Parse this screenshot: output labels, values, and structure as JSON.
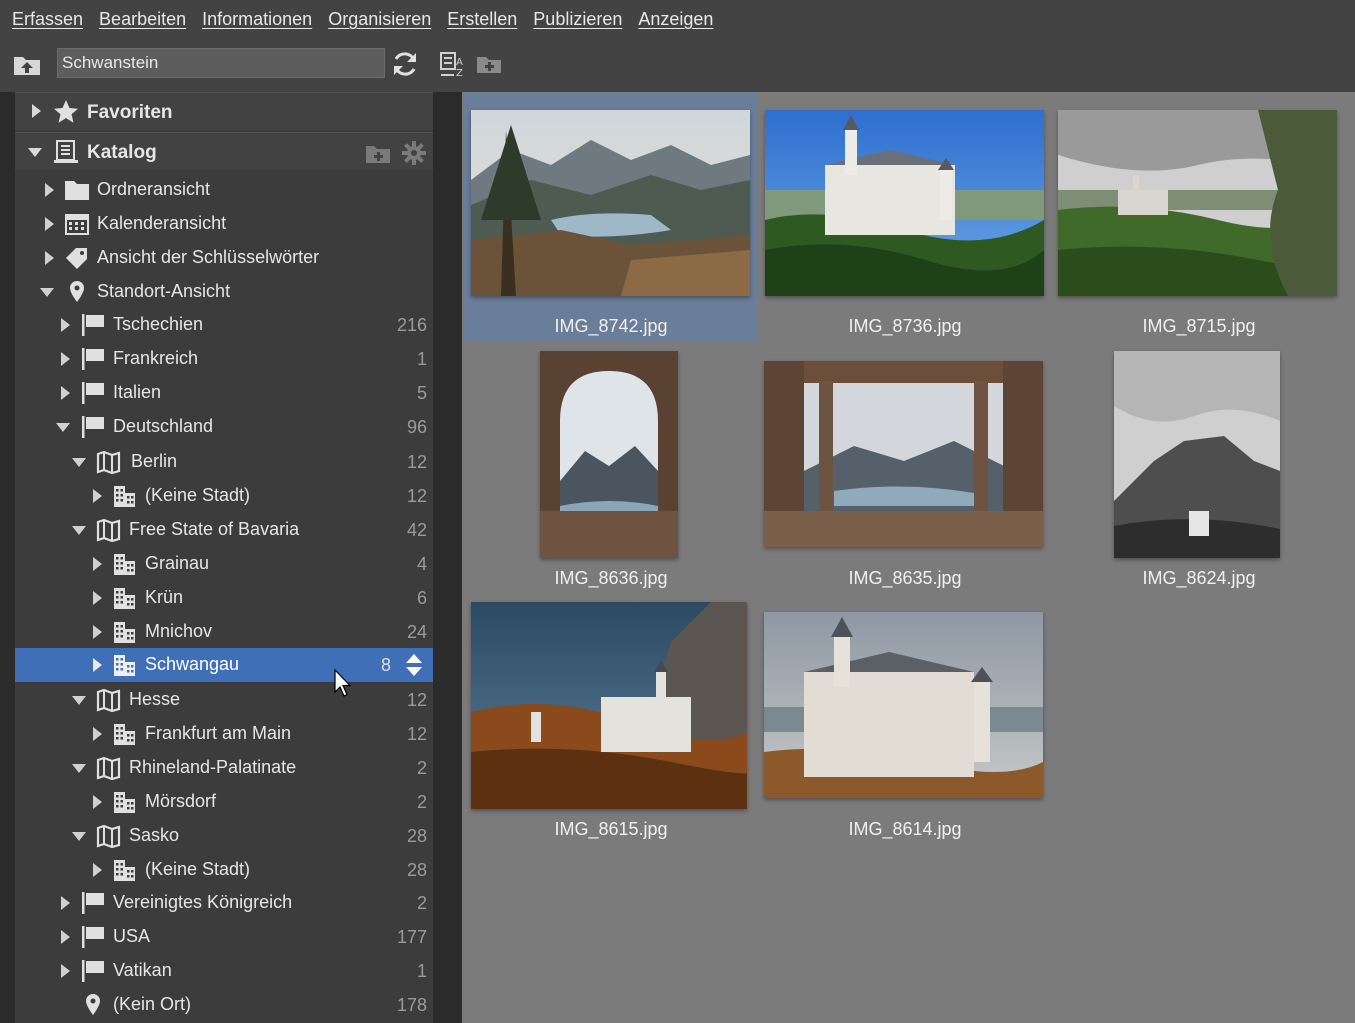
{
  "menu": [
    "Erfassen",
    "Bearbeiten",
    "Informationen",
    "Organisieren",
    "Erstellen",
    "Publizieren",
    "Anzeigen"
  ],
  "search": {
    "value": "Schwanstein"
  },
  "sidebar": {
    "favorites": "Favoriten",
    "catalog": "Katalog",
    "rows": [
      {
        "label": "Ordneransicht",
        "count": ""
      },
      {
        "label": "Kalenderansicht",
        "count": ""
      },
      {
        "label": "Ansicht der Schlüsselwörter",
        "count": ""
      },
      {
        "label": "Standort-Ansicht",
        "count": ""
      },
      {
        "label": "Tschechien",
        "count": "216"
      },
      {
        "label": "Frankreich",
        "count": "1"
      },
      {
        "label": "Italien",
        "count": "5"
      },
      {
        "label": "Deutschland",
        "count": "96"
      },
      {
        "label": "Berlin",
        "count": "12"
      },
      {
        "label": "(Keine Stadt)",
        "count": "12"
      },
      {
        "label": "Free State of Bavaria",
        "count": "42"
      },
      {
        "label": "Grainau",
        "count": "4"
      },
      {
        "label": "Krün",
        "count": "6"
      },
      {
        "label": "Mnichov",
        "count": "24"
      },
      {
        "label": "Schwangau",
        "count": "8"
      },
      {
        "label": "Hesse",
        "count": "12"
      },
      {
        "label": "Frankfurt am Main",
        "count": "12"
      },
      {
        "label": "Rhineland-Palatinate",
        "count": "2"
      },
      {
        "label": "Mörsdorf",
        "count": "2"
      },
      {
        "label": "Sasko",
        "count": "28"
      },
      {
        "label": "(Keine Stadt)",
        "count": "28"
      },
      {
        "label": "Vereinigtes Königreich",
        "count": "2"
      },
      {
        "label": "USA",
        "count": "177"
      },
      {
        "label": "Vatikan",
        "count": "1"
      },
      {
        "label": "(Kein Ort)",
        "count": "178"
      }
    ]
  },
  "thumbnails": [
    {
      "name": "IMG_8742.jpg"
    },
    {
      "name": "IMG_8736.jpg"
    },
    {
      "name": "IMG_8715.jpg"
    },
    {
      "name": "IMG_8636.jpg"
    },
    {
      "name": "IMG_8635.jpg"
    },
    {
      "name": "IMG_8624.jpg"
    },
    {
      "name": "IMG_8615.jpg"
    },
    {
      "name": "IMG_8614.jpg"
    }
  ],
  "colors": {
    "accent": "#3f6fb6",
    "grid_bg": "#7b7b7b",
    "sidebar_bg": "#3c3c3c",
    "toolbar_bg": "#434343"
  }
}
